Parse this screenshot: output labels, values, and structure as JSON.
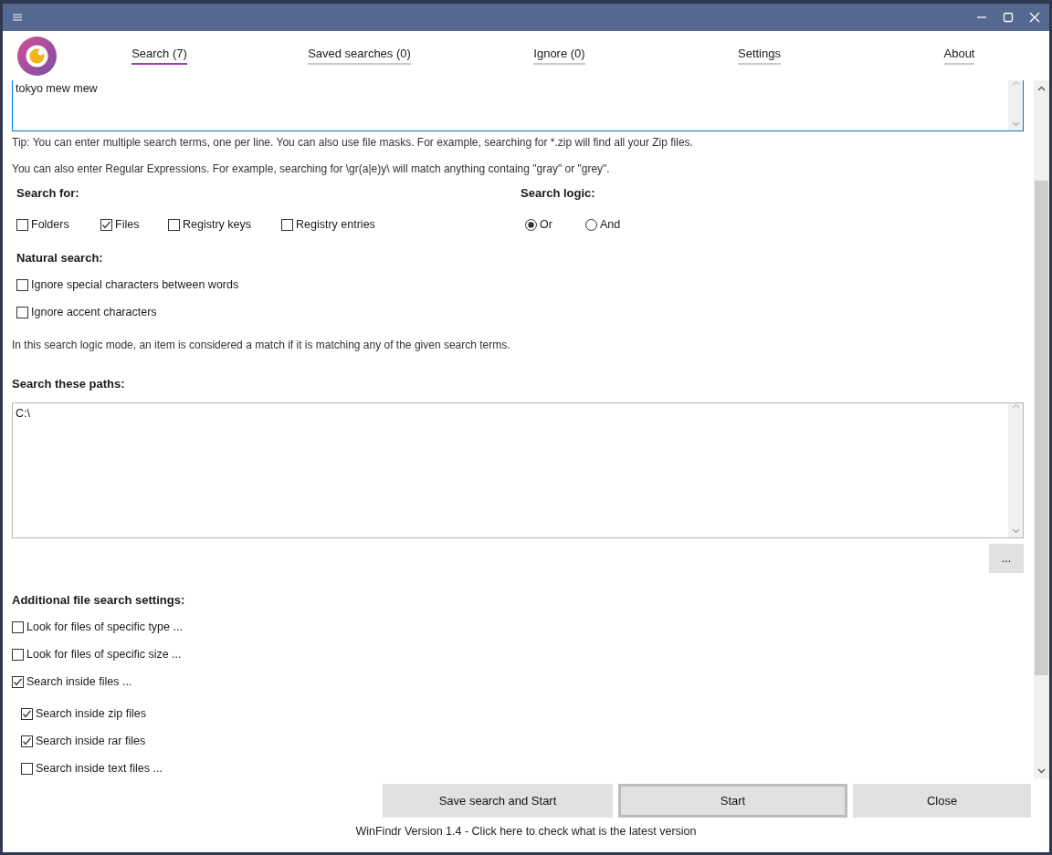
{
  "tabs": [
    {
      "label": "Search (7)",
      "selected": true
    },
    {
      "label": "Saved searches (0)",
      "selected": false
    },
    {
      "label": "Ignore (0)",
      "selected": false
    },
    {
      "label": "Settings",
      "selected": false
    },
    {
      "label": "About",
      "selected": false
    }
  ],
  "search_terms": {
    "value": "tokyo mew mew"
  },
  "tips": [
    "Tip: You can enter multiple search terms, one per line. You can also use file masks. For example, searching for *.zip will find all your Zip files.",
    "You can also enter Regular Expressions. For example, searching for \\gr(a|e)y\\ will match anything containg \"gray\" or \"grey\"."
  ],
  "search_for": {
    "heading": "Search for:",
    "options": [
      {
        "label": "Folders",
        "checked": false
      },
      {
        "label": "Files",
        "checked": true
      },
      {
        "label": "Registry keys",
        "checked": false
      },
      {
        "label": "Registry entries",
        "checked": false
      }
    ]
  },
  "search_logic": {
    "heading": "Search logic:",
    "options": [
      {
        "label": "Or",
        "selected": true
      },
      {
        "label": "And",
        "selected": false
      }
    ]
  },
  "natural_search": {
    "heading": "Natural search:",
    "options": [
      {
        "label": "Ignore special characters between words",
        "checked": false
      },
      {
        "label": "Ignore accent characters",
        "checked": false
      }
    ]
  },
  "logic_note": "In this search logic mode, an item is considered a match if it is matching any of the given search terms.",
  "paths": {
    "heading": "Search these paths:",
    "value": "C:\\",
    "browse_button": "..."
  },
  "additional": {
    "heading": "Additional file search settings:",
    "options": [
      {
        "label": "Look for files of specific type ...",
        "checked": false
      },
      {
        "label": "Look for files of specific size ...",
        "checked": false
      },
      {
        "label": "Search inside files ...",
        "checked": true,
        "children": [
          {
            "label": "Search inside zip files",
            "checked": true
          },
          {
            "label": "Search inside rar files",
            "checked": true
          },
          {
            "label": "Search inside text files ...",
            "checked": false
          }
        ]
      }
    ]
  },
  "buttons": [
    {
      "label": "Save search and Start",
      "default": false
    },
    {
      "label": "Start",
      "default": true
    },
    {
      "label": "Close",
      "default": false
    }
  ],
  "footer": "WinFindr Version 1.4 - Click here to check what is the latest version"
}
